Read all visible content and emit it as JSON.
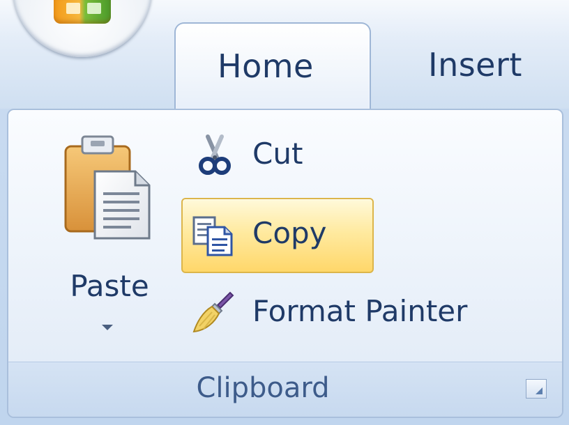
{
  "tabs": {
    "home": "Home",
    "insert": "Insert"
  },
  "clipboard_group": {
    "paste_label": "Paste",
    "cut_label": "Cut",
    "copy_label": "Copy",
    "format_painter_label": "Format Painter",
    "group_label": "Clipboard"
  },
  "icons": {
    "office_button": "office-orb-icon",
    "paste": "clipboard-paste-icon",
    "cut": "scissors-icon",
    "copy": "copy-pages-icon",
    "format_painter": "paintbrush-icon",
    "dialog_launcher": "dialog-launcher-icon",
    "dropdown": "chevron-down-icon"
  },
  "colors": {
    "ribbon_text": "#1f3a67",
    "copy_highlight": "#ffd76a",
    "panel_border": "#a9bfdc"
  }
}
